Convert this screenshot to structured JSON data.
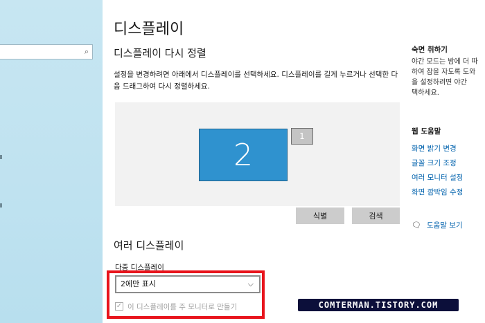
{
  "sidebar": {
    "search_placeholder": ""
  },
  "main": {
    "page_title": "디스플레이",
    "arrange_title": "디스플레이 다시 정렬",
    "arrange_desc": "설정을 변경하려면 아래에서 디스플레이를 선택하세요. 디스플레이를 길게 누르거나 선택한 다음 드래그하여 다시 정렬하세요.",
    "monitors": [
      {
        "label": "2"
      },
      {
        "label": "1"
      }
    ],
    "identify_label": "식별",
    "detect_label": "검색",
    "multi_title": "여러 디스플레이",
    "multi_field_label": "다중 디스플레이",
    "multi_selected": "2에만 표시",
    "make_main_label": "이 디스플레이를 주 모니터로 만들기"
  },
  "right": {
    "sleep_title": "숙면 취하기",
    "sleep_lines": [
      "야간 모드는 밤에 더 따",
      "하여 잠을 자도록 도와",
      "을 설정하려면 야간",
      "택하세요."
    ],
    "web_help_title": "웹 도움말",
    "links": [
      "화면 밝기 변경",
      "글꼴 크기 조정",
      "여러 모니터 설정",
      "화면 깜박임 수정"
    ],
    "help_link": "도움말 보기"
  },
  "watermark": "COMTERMAN.TISTORY.COM"
}
